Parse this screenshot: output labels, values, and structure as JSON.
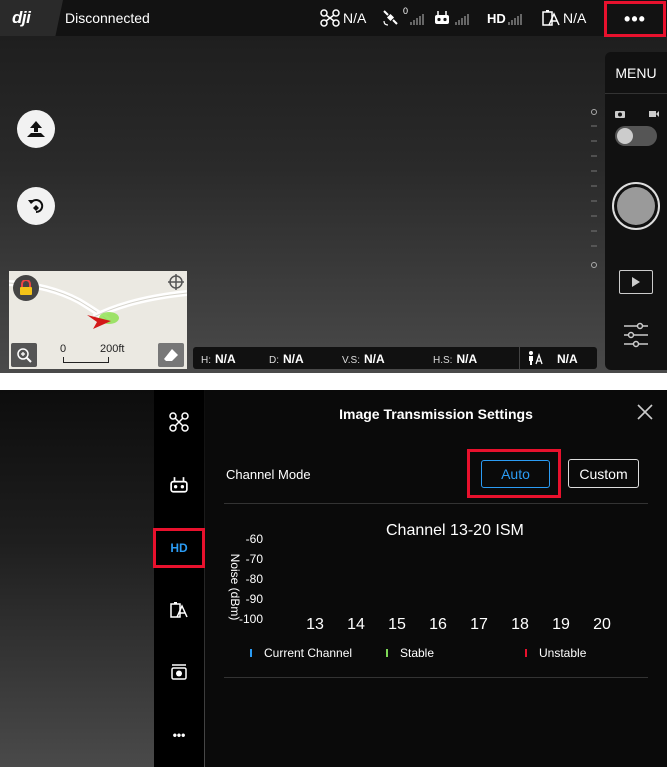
{
  "top": {
    "logo": "dji",
    "status": "Disconnected",
    "aircraft_value": "N/A",
    "gps_count": "0",
    "battery_value": "N/A",
    "hd_label": "HD",
    "menu_label": "MENU",
    "map": {
      "scale_start": "0",
      "scale_end": "200ft"
    },
    "telemetry": {
      "h_label": "H:",
      "h_value": "N/A",
      "d_label": "D:",
      "d_value": "N/A",
      "vs_label": "V.S:",
      "vs_value": "N/A",
      "hs_label": "H.S:",
      "hs_value": "N/A",
      "dist_value": "N/A"
    },
    "icons": {
      "aircraft": "drone-icon",
      "gps": "satellite-icon",
      "remote": "remote-controller-icon",
      "battery": "battery-icon",
      "more": "more-icon",
      "takeoff": "takeoff-icon",
      "rth": "return-home-icon"
    }
  },
  "settings": {
    "title": "Image Transmission Settings",
    "channel_mode_label": "Channel Mode",
    "auto_label": "Auto",
    "custom_label": "Custom",
    "side_hd_label": "HD",
    "side_more": "•••",
    "accent": "#2b9cf4",
    "highlight": "#e8112d",
    "chart_data": {
      "type": "bar",
      "title": "Channel 13-20 ISM",
      "ylabel": "Noise (dBm)",
      "yticks": [
        "-60",
        "-70",
        "-80",
        "-90",
        "-100"
      ],
      "categories": [
        "13",
        "14",
        "15",
        "16",
        "17",
        "18",
        "19",
        "20"
      ],
      "legend": [
        {
          "label": "Current Channel",
          "color": "#2b9cf4"
        },
        {
          "label": "Stable",
          "color": "#7ed957"
        },
        {
          "label": "Unstable",
          "color": "#e8112d"
        }
      ]
    }
  }
}
